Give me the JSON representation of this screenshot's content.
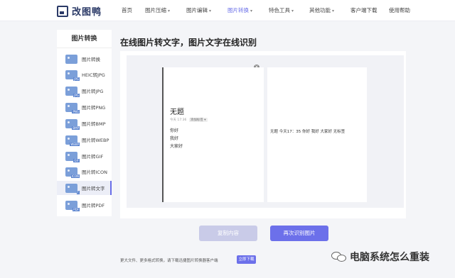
{
  "brand": {
    "name": "改图鸭"
  },
  "nav": [
    {
      "label": "首页",
      "caret": false,
      "active": false
    },
    {
      "label": "图片压缩",
      "caret": true,
      "active": false
    },
    {
      "label": "图片编辑",
      "caret": true,
      "active": false
    },
    {
      "label": "图片转换",
      "caret": true,
      "active": true
    },
    {
      "label": "特色工具",
      "caret": true,
      "active": false
    },
    {
      "label": "其他功能",
      "caret": true,
      "active": false
    },
    {
      "label": "客户端下载",
      "caret": false,
      "active": false
    },
    {
      "label": "使用帮助",
      "caret": false,
      "active": false
    }
  ],
  "sidebar": {
    "title": "图片转换",
    "items": [
      {
        "label": "图片转换",
        "tag": "",
        "active": false
      },
      {
        "label": "HEIC转JPG",
        "tag": "JPG",
        "active": false
      },
      {
        "label": "图片转JPG",
        "tag": "JPG",
        "active": false
      },
      {
        "label": "图片转PNG",
        "tag": "PNG",
        "active": false
      },
      {
        "label": "图片转BMP",
        "tag": "BMP",
        "active": false
      },
      {
        "label": "图片转WEBP",
        "tag": "WEBP",
        "active": false
      },
      {
        "label": "图片转GIF",
        "tag": "GIF",
        "active": false
      },
      {
        "label": "图片转ICON",
        "tag": "ICON",
        "active": false
      },
      {
        "label": "图片转文字",
        "tag": "T",
        "active": true
      },
      {
        "label": "图片转PDF",
        "tag": "PDF",
        "active": false
      }
    ]
  },
  "main": {
    "title": "在线图片转文字，图片文字在线识别",
    "preview": {
      "doc_title": "无题",
      "doc_meta": "今天 17:36",
      "doc_tag": "添加标签",
      "lines": [
        "你好",
        "我好",
        "大家好"
      ]
    },
    "result_text": "无题 今天17：35 你好 我好 大家好 无标签",
    "copy_label": "复制内容",
    "again_label": "再次识别图片"
  },
  "footer": {
    "note": "更大文件、更多格式转换，请下载迅捷图片转换器客户端",
    "download_label": "立即下载"
  },
  "watermark": {
    "text": "电脑系统怎么重装"
  }
}
